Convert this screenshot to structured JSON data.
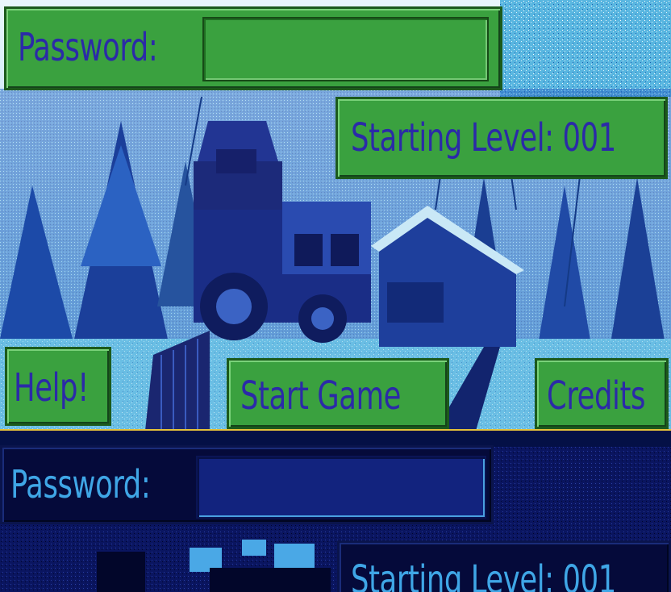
{
  "top_screen": {
    "password_label": "Password:",
    "password_value": "",
    "starting_level_label": "Starting Level: 001",
    "buttons": {
      "help": "Help!",
      "start_game": "Start Game",
      "credits": "Credits"
    }
  },
  "bottom_screen": {
    "password_label": "Password:",
    "password_value": "",
    "starting_level_label": "Starting Level: 001"
  },
  "colors": {
    "button_green": "#3aa13f",
    "label_blue": "#2b2aa8",
    "dark_panel": "#050a3a",
    "dark_label": "#3fa6e6"
  }
}
